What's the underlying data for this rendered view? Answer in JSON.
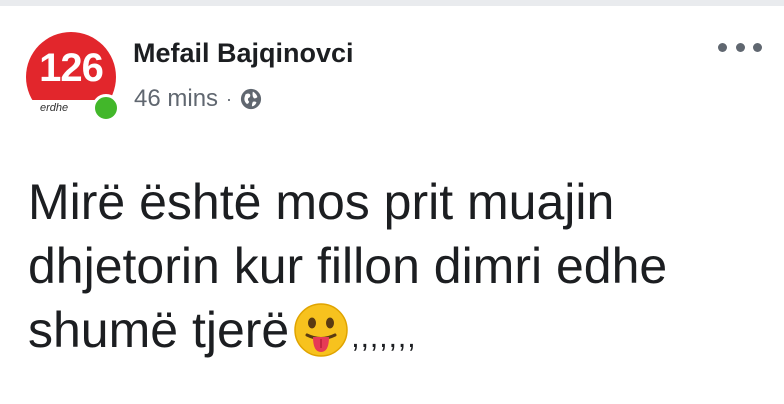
{
  "post": {
    "author": "Mefail Bajqinovci",
    "time": "46 mins",
    "separator": "·",
    "privacy_icon": "globe-icon",
    "more_icon": "more-options-icon",
    "avatar": {
      "number": "126",
      "text": "erdhe"
    },
    "text_lines": [
      "Mirë është mos prit muajin",
      "dhjetorin kur fillon dimri edhe",
      "shumë tjerë"
    ],
    "emoji": "tongue-out-emoji",
    "trailing": ",,,,,,,"
  },
  "colors": {
    "avatar_red": "#e2262c",
    "online_green": "#42b72a",
    "meta_gray": "#606770",
    "text": "#1c1e21"
  }
}
